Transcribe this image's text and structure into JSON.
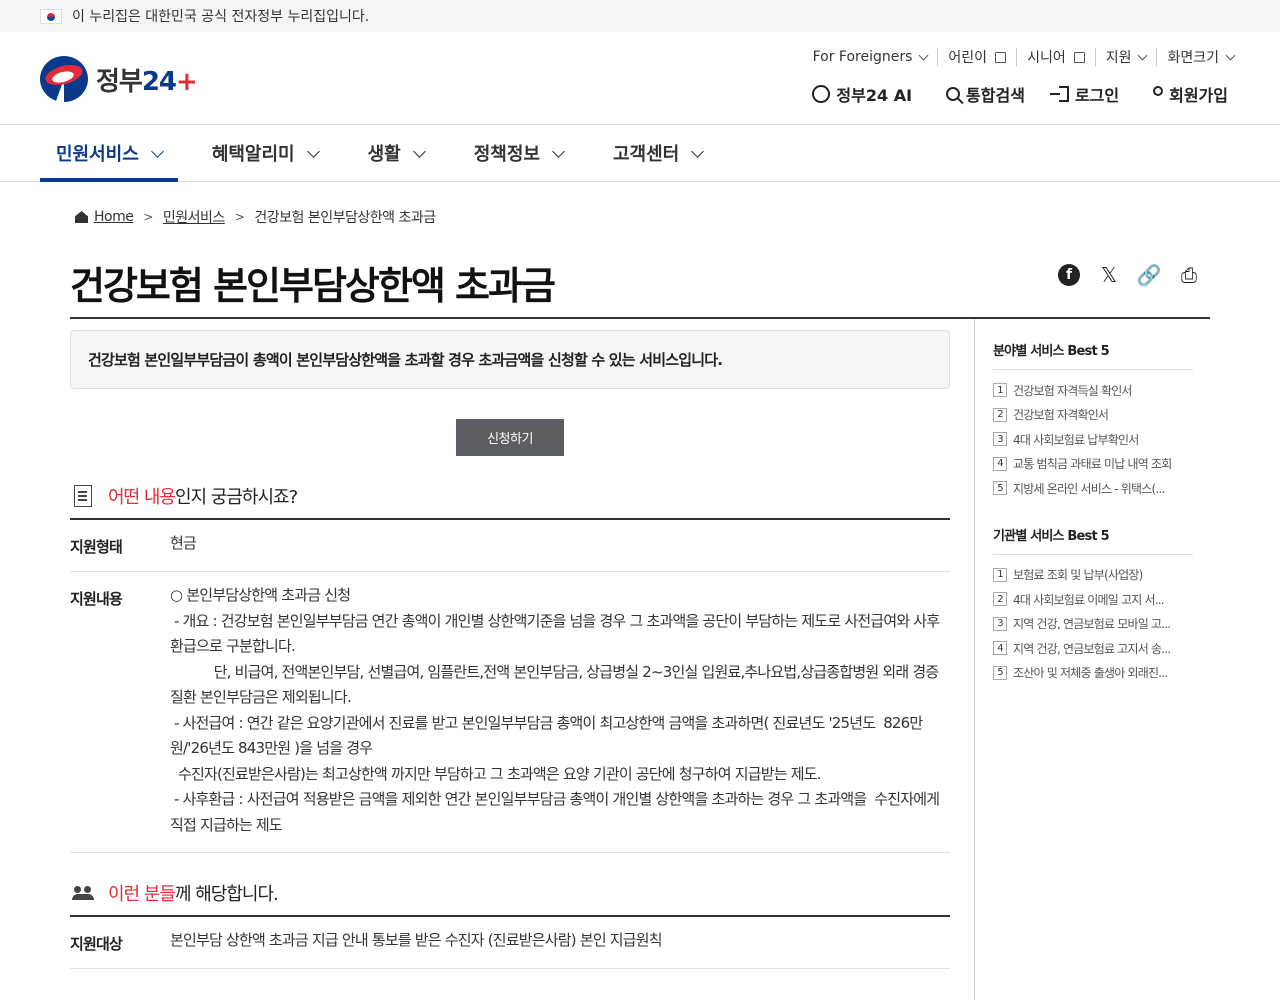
{
  "gov_banner": {
    "text": "이 누리집은 대한민국 공식 전자정부 누리집입니다."
  },
  "logo": {
    "text": "정부",
    "num": "24",
    "plus": "+"
  },
  "util_top": {
    "foreigners": "For Foreigners",
    "kids": "어린이",
    "senior": "시니어",
    "support": "지원",
    "display": "화면크기"
  },
  "util_bottom": {
    "ai": "정부24 AI",
    "search": "통합검색",
    "login": "로그인",
    "join": "회원가입"
  },
  "gnb": [
    {
      "label": "민원서비스",
      "active": true
    },
    {
      "label": "혜택알리미"
    },
    {
      "label": "생활"
    },
    {
      "label": "정책정보"
    },
    {
      "label": "고객센터"
    }
  ],
  "breadcrumb": {
    "home": "Home",
    "level1": "민원서비스",
    "current": "건강보험 본인부담상한액 초과금"
  },
  "page_title": "건강보험 본인부담상한액 초과금",
  "summary": "건강보험 본인일부부담금이 총액이 본인부담상한액을 초과할 경우 초과금액을 신청할 수 있는 서비스입니다.",
  "apply_button": "신청하기",
  "section1": {
    "highlight": "어떤 내용",
    "rest": "인지 궁금하시죠?",
    "rows": [
      {
        "key": "지원형태",
        "value": "현금"
      },
      {
        "key": "지원내용",
        "value": "○ 본인부담상한액 초과금 신청\n - 개요 : 건강보험 본인일부부담금 연간 총액이 개인별 상한액기준을 넘을 경우 그 초과액을 공단이 부담하는 제도로 사전급여와 사후환급으로 구분합니다.\n           단, 비급여, 전액본인부담, 선별급여, 임플란트,전액 본인부담금, 상급병실 2~3인실 입원료,추나요법,상급종합병원 외래 경증질환 본인부담금은 제외됩니다.\n - 사전급여 : 연간 같은 요양기관에서 진료를 받고 본인일부부담금 총액이 최고상한액 금액을 초과하면( 진료년도 '25년도  826만원/'26년도 843만원 )을 넘을 경우\n  수진자(진료받은사람)는 최고상한액 까지만 부담하고 그 초과액은 요양 기관이 공단에 청구하여 지급받는 제도.\n - 사후환급 : 사전급여 적용받은 금액을 제외한 연간 본인일부부담금 총액이 개인별 상한액을 초과하는 경우 그 초과액을  수진자에게 직접 지급하는 제도"
      }
    ]
  },
  "section2": {
    "highlight": "이런 분들",
    "rest": "께 해당합니다.",
    "rows": [
      {
        "key": "지원대상",
        "value": "본인부담 상한액 초과금 지급 안내 통보를 받은 수진자 (진료받은사람) 본인 지급원칙"
      }
    ]
  },
  "sidebar": {
    "field_title": "분야별 서비스 Best 5",
    "field_items": [
      "건강보험 자격득실 확인서",
      "건강보험 자격확인서",
      "4대 사회보험료 납부확인서",
      "교통 범칙금 과태료 미납 내역 조회",
      "지방세 온라인 서비스 - 위택스(..."
    ],
    "agency_title": "기관별 서비스 Best 5",
    "agency_items": [
      "보험료 조회 및 납부(사업장)",
      "4대 사회보험료 이메일 고지 서...",
      "지역 건강, 연금보험료 모바일 고...",
      "지역 건강, 연금보험료 고지서 송...",
      "조산아 및 저체중 출생아 외래진..."
    ]
  },
  "colors": {
    "brand_blue": "#0b3a8c",
    "accent_red": "#e52b3a",
    "button_gray": "#5b5e63"
  }
}
